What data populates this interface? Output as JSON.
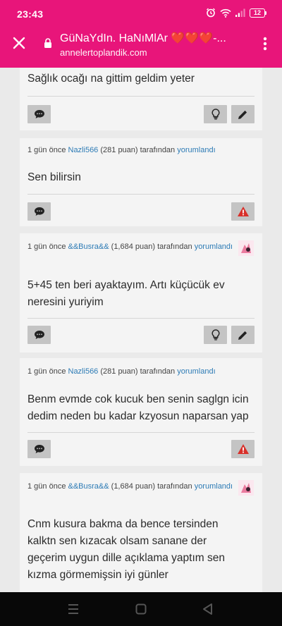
{
  "status_bar": {
    "time": "23:43",
    "battery": "12"
  },
  "browser": {
    "page_title": "GüNaYdIn. HaNıMlAr ❤️❤️❤️-...",
    "url": "annelertoplandik.com"
  },
  "colors": {
    "brand": "#e8157a",
    "link": "#2d7bb5",
    "warning": "#d8302a"
  },
  "comments": [
    {
      "text": "Sağlık ocağı na gittim geldim yeter",
      "actions": [
        "comment-icon",
        "lightbulb-icon",
        "pencil-icon"
      ]
    },
    {
      "meta_prefix": "1 gün önce ",
      "user": "Nazli566",
      "points": " (281 puan) tarafından ",
      "verb": "yorumlandı",
      "text": "Sen bilirsin",
      "actions": [
        "comment-icon",
        "warning-icon"
      ]
    },
    {
      "meta_prefix": "1 gün önce ",
      "user": "&&Busra&&",
      "points": " (1,684 puan) tarafından ",
      "verb": "yorumlandı",
      "text": "5+45 ten beri ayaktayım.  Artı küçücük ev neresini yuriyim",
      "actions": [
        "comment-icon",
        "lightbulb-icon",
        "pencil-icon"
      ]
    },
    {
      "meta_prefix": "1 gün önce ",
      "user": "Nazli566",
      "points": " (281 puan) tarafından ",
      "verb": "yorumlandı",
      "text": "Benm evmde cok kucuk ben senin saglgn icin dedim neden bu kadar kzyosun naparsan yap",
      "actions": [
        "comment-icon",
        "warning-icon"
      ]
    },
    {
      "meta_prefix": "1 gün önce ",
      "user": "&&Busra&&",
      "points": " (1,684 puan) tarafından ",
      "verb": "yorumlandı",
      "text": "Cnm kusura bakma da bence tersinden kalktn sen kızacak olsam sanane der geçerim uygun dille açıklama yaptım sen kızma görmemişsin iyi günler"
    }
  ]
}
